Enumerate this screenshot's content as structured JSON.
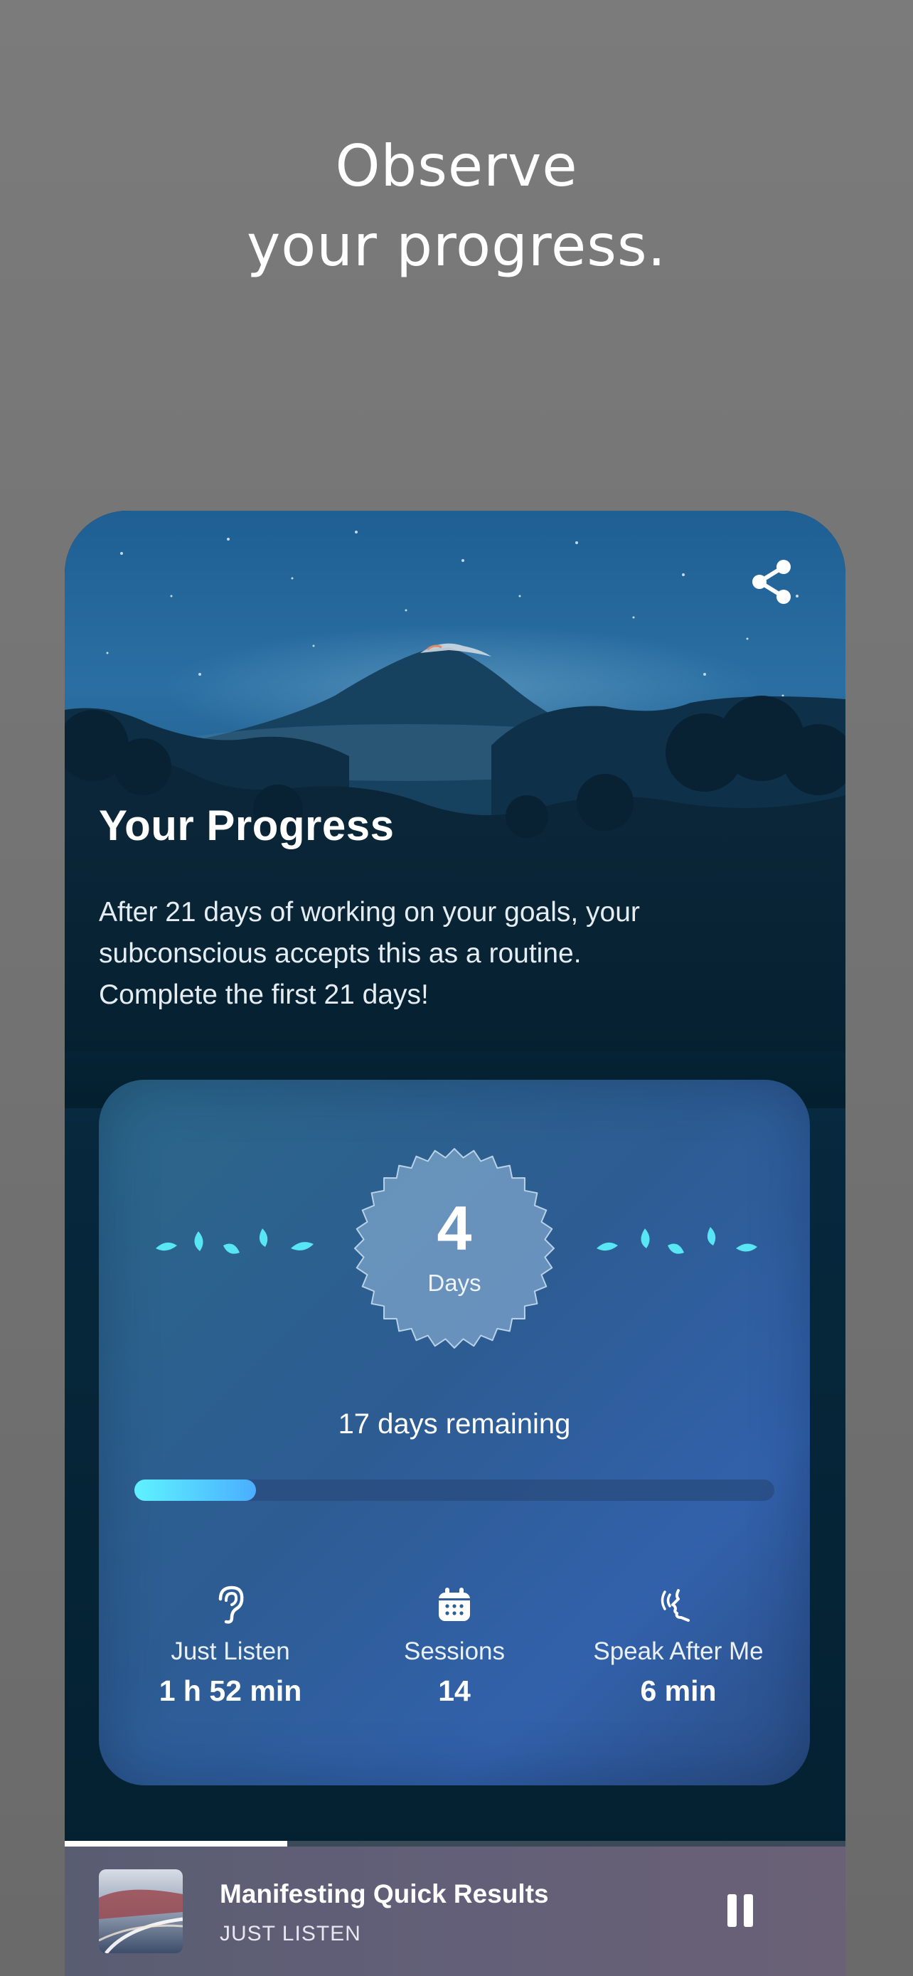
{
  "hero": {
    "line1": "Observe",
    "line2": "your progress."
  },
  "card": {
    "title": "Your Progress",
    "description": [
      "After 21 days of working on your goals, your",
      "subconscious accepts this as a routine.",
      "Complete the first 21 days!"
    ],
    "share_icon": "share-icon"
  },
  "badge": {
    "count": "4",
    "unit": "Days"
  },
  "progress": {
    "remaining_text": "17 days remaining",
    "completed_days": 4,
    "total_days": 21
  },
  "stats": [
    {
      "icon": "ear-icon",
      "label": "Just Listen",
      "value": "1 h 52 min"
    },
    {
      "icon": "calendar-icon",
      "label": "Sessions",
      "value": "14"
    },
    {
      "icon": "speaking-head-icon",
      "label": "Speak After Me",
      "value": "6 min"
    }
  ],
  "player": {
    "title": "Manifesting Quick Results",
    "subtitle": "JUST LISTEN",
    "playback_fraction": 0.285,
    "control_icon": "pause-icon"
  },
  "colors": {
    "accent_cyan": "#5ff2ff",
    "panel_blue": "#3261ab",
    "card_dark": "#04202f"
  }
}
